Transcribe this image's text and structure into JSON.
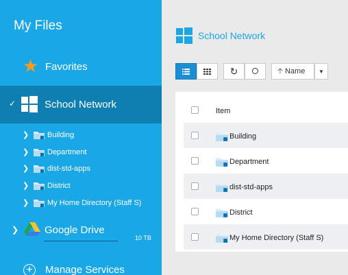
{
  "sidebar": {
    "title": "My Files",
    "favorites_label": "Favorites",
    "school_network_label": "School Network",
    "tree": [
      {
        "label": "Building"
      },
      {
        "label": "Department"
      },
      {
        "label": "dist-std-apps"
      },
      {
        "label": "District"
      },
      {
        "label": "My Home Directory (Staff S)"
      }
    ],
    "google_drive_label": "Google Drive",
    "google_drive_size": "10 TB",
    "manage_services_label": "Manage Services"
  },
  "main": {
    "breadcrumb": "School Network",
    "toolbar": {
      "list_view_icon": "list-icon",
      "grid_view_icon": "grid-icon",
      "refresh_icon": "refresh-icon",
      "recent_icon": "clock-icon",
      "sort_label": "Name"
    },
    "header_label": "Item",
    "rows": [
      {
        "label": "Building"
      },
      {
        "label": "Department"
      },
      {
        "label": "dist-std-apps"
      },
      {
        "label": "District"
      },
      {
        "label": "My Home Directory (Staff S)"
      }
    ]
  },
  "colors": {
    "sidebar": "#1aa7e6",
    "sidebar_selected": "#0e7fb0",
    "accent": "#1a8fd4",
    "star": "#f39c1f"
  }
}
